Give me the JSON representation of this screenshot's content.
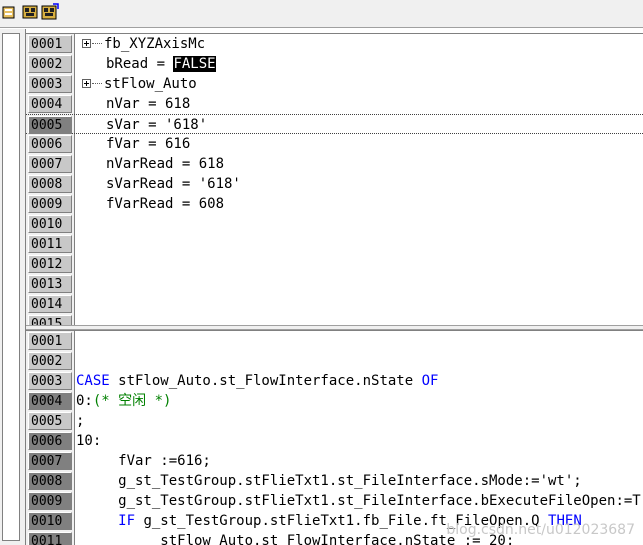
{
  "toolbar": {
    "buttons": [
      {
        "name": "open-icon"
      },
      {
        "name": "online-view-icon"
      },
      {
        "name": "online-write-icon"
      }
    ]
  },
  "declaration_pane": {
    "rows": [
      {
        "line": "0001",
        "text": "fb_XYZAxisMc",
        "tree": true
      },
      {
        "line": "0002",
        "text": "bRead = ",
        "value": "FALSE"
      },
      {
        "line": "0003",
        "text": "stFlow_Auto",
        "tree": true
      },
      {
        "line": "0004",
        "text": "nVar = 618"
      },
      {
        "line": "0005",
        "text": "sVar = '618'"
      },
      {
        "line": "0006",
        "text": "fVar = 616"
      },
      {
        "line": "0007",
        "text": "nVarRead = 618"
      },
      {
        "line": "0008",
        "text": "sVarRead = '618'"
      },
      {
        "line": "0009",
        "text": "fVarRead = 608"
      },
      {
        "line": "0010",
        "text": ""
      },
      {
        "line": "0011",
        "text": ""
      },
      {
        "line": "0012",
        "text": ""
      },
      {
        "line": "0013",
        "text": ""
      },
      {
        "line": "0014",
        "text": ""
      },
      {
        "line": "0015",
        "text": ""
      }
    ]
  },
  "code_pane": {
    "rows": [
      {
        "line": "0001"
      },
      {
        "line": "0002"
      },
      {
        "line": "0003",
        "kw1": "CASE",
        "plain1": " stFlow_Auto.st_FlowInterface.nState ",
        "kw2": "OF"
      },
      {
        "line": "0004",
        "plain1": "0:",
        "comment": "(* 空闲 *)"
      },
      {
        "line": "0005",
        "plain1": ";"
      },
      {
        "line": "0006",
        "plain1": "10:"
      },
      {
        "line": "0007",
        "plain1": "     fVar :=616;"
      },
      {
        "line": "0008",
        "plain1": "     g_st_TestGroup.stFlieTxt1.st_FileInterface.sMode:='wt';"
      },
      {
        "line": "0009",
        "plain1": "     g_st_TestGroup.stFlieTxt1.st_FileInterface.bExecuteFileOpen:=T"
      },
      {
        "line": "0010",
        "kw1": "     IF",
        "plain1": " g_st_TestGroup.stFlieTxt1.fb_File.ft_FileOpen.Q ",
        "kw2": "THEN"
      },
      {
        "line": "0011",
        "plain1": "          stFlow_Auto.st_FlowInterface.nState := 20;"
      }
    ]
  },
  "watermark": "blog.csdn.net/u012023687"
}
